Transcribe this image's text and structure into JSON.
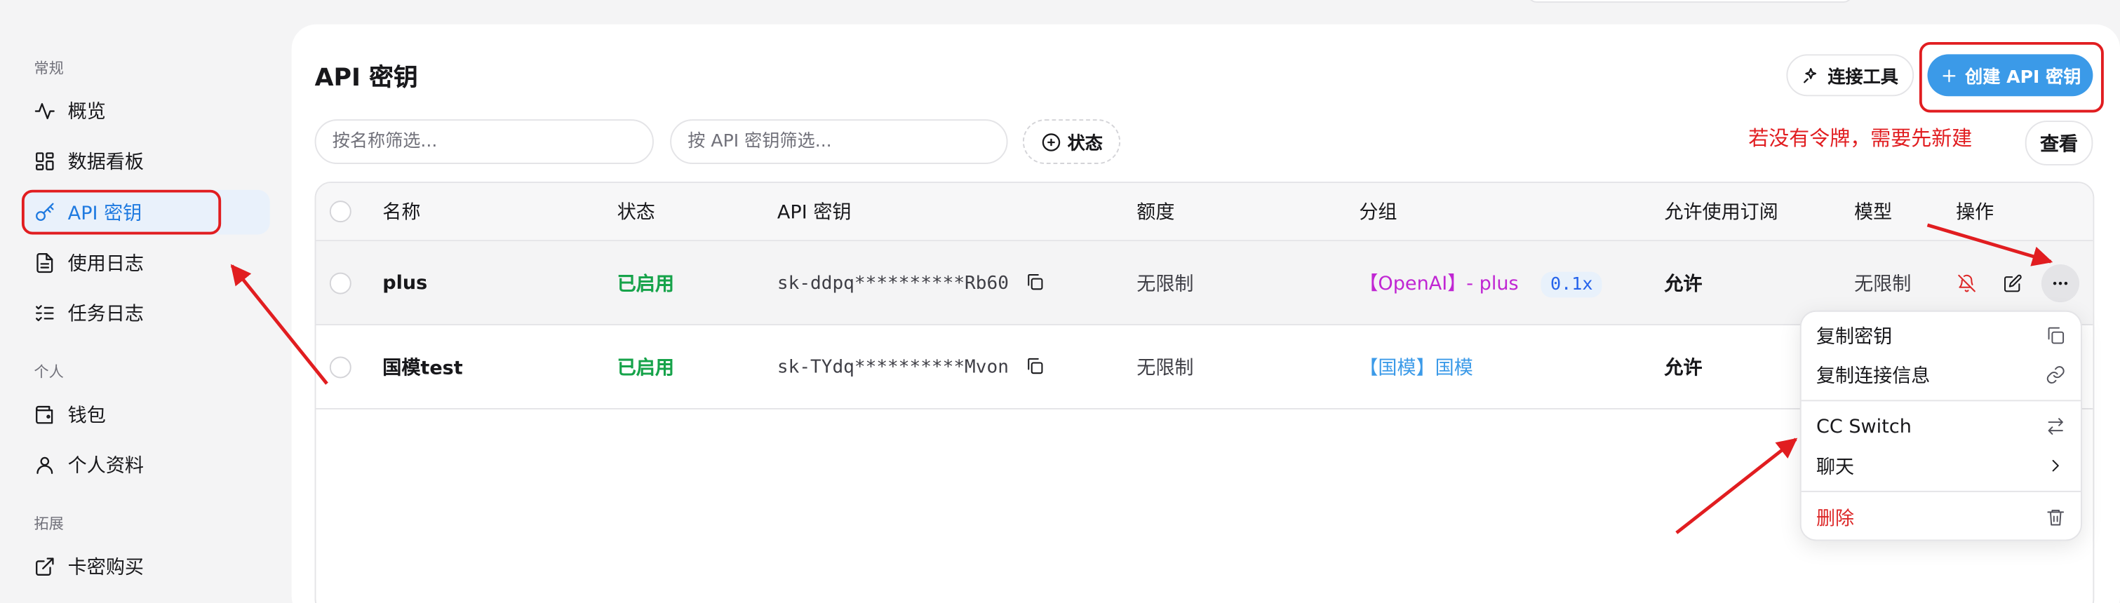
{
  "sidebar": {
    "sections": [
      {
        "label": "常规",
        "items": [
          {
            "label": "概览",
            "icon": "activity-icon"
          },
          {
            "label": "数据看板",
            "icon": "dashboard-icon"
          },
          {
            "label": "API 密钥",
            "icon": "key-icon",
            "active": true
          },
          {
            "label": "使用日志",
            "icon": "document-icon"
          },
          {
            "label": "任务日志",
            "icon": "list-check-icon"
          }
        ]
      },
      {
        "label": "个人",
        "items": [
          {
            "label": "钱包",
            "icon": "wallet-icon"
          },
          {
            "label": "个人资料",
            "icon": "user-icon"
          }
        ]
      },
      {
        "label": "拓展",
        "items": [
          {
            "label": "卡密购买",
            "icon": "external-link-icon"
          }
        ]
      }
    ]
  },
  "header": {
    "title": "API 密钥",
    "connect_tools_label": "连接工具",
    "create_key_label": "创建 API 密钥",
    "view_label": "查看"
  },
  "filters": {
    "name_placeholder": "按名称筛选...",
    "key_placeholder": "按 API 密钥筛选...",
    "status_label": "状态"
  },
  "table": {
    "columns": [
      "名称",
      "状态",
      "API 密钥",
      "额度",
      "分组",
      "允许使用订阅",
      "模型",
      "操作"
    ],
    "rows": [
      {
        "name": "plus",
        "status": "已启用",
        "key": "sk-ddpq**********Rb60",
        "quota": "无限制",
        "group": "【OpenAI】- plus",
        "ratio": "0.1x",
        "subscription": "允许",
        "models": "无限制"
      },
      {
        "name": "国模test",
        "status": "已启用",
        "key": "sk-TYdq**********Mvon",
        "quota": "无限制",
        "group": "【国模】国模",
        "ratio": "",
        "subscription": "允许",
        "models": ""
      }
    ]
  },
  "menu": {
    "items": [
      {
        "label": "复制密钥",
        "icon": "copy-icon"
      },
      {
        "label": "复制连接信息",
        "icon": "link-icon"
      },
      {
        "label": "CC Switch",
        "icon": "swap-icon"
      },
      {
        "label": "聊天",
        "icon": "chevron-right-icon"
      },
      {
        "label": "删除",
        "icon": "trash-icon",
        "danger": true
      }
    ]
  },
  "annotation": {
    "note": "若没有令牌，需要先新建",
    "color": "#e11d20"
  },
  "colors": {
    "accent": "#3b9ae8",
    "active_bg": "#e9f1fb",
    "enabled": "#16a34a",
    "group_purple": "#c026d3"
  }
}
